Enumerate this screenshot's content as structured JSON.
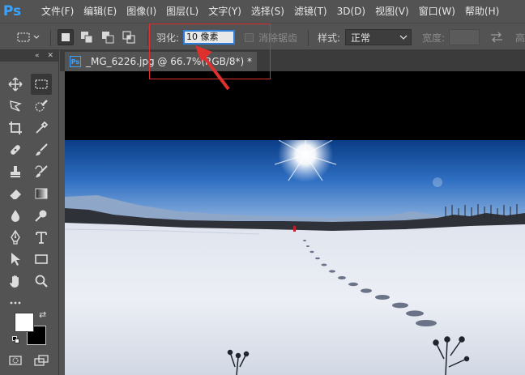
{
  "app": {
    "logo": "Ps"
  },
  "menu": [
    "文件(F)",
    "编辑(E)",
    "图像(I)",
    "图层(L)",
    "文字(Y)",
    "选择(S)",
    "滤镜(T)",
    "3D(D)",
    "视图(V)",
    "窗口(W)",
    "帮助(H)"
  ],
  "options": {
    "feather_label": "羽化:",
    "feather_value": "10 像素",
    "antialias_label": "消除锯齿",
    "style_label": "样式:",
    "style_value": "正常",
    "width_label": "宽度:"
  },
  "document": {
    "tab_icon": "Ps",
    "tab_title": "_MG_6226.jpg @ 66.7%(RGB/8*) *"
  },
  "colors": {
    "foreground": "#ffffff",
    "background": "#000000",
    "annotation": "#e0302e",
    "accent": "#3aa3ff"
  }
}
